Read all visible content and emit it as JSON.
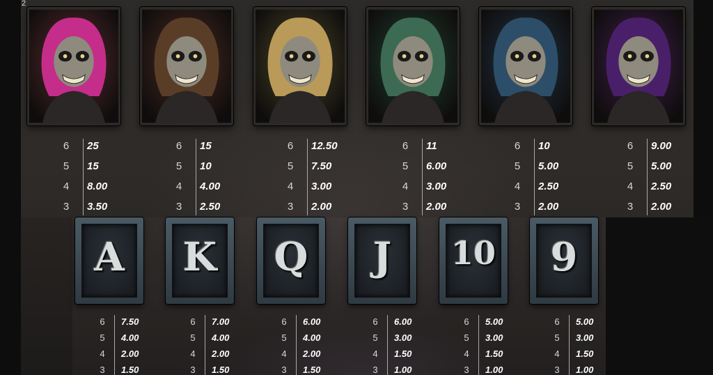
{
  "page_number": "2",
  "premium_symbols": [
    {
      "name": "pink-pompadour-zombie-symbol",
      "bg": "#5a2a2e",
      "hair": "#c52d8a",
      "pays": [
        {
          "count": "6",
          "value": "25"
        },
        {
          "count": "5",
          "value": "15"
        },
        {
          "count": "4",
          "value": "8.00"
        },
        {
          "count": "3",
          "value": "3.50"
        }
      ]
    },
    {
      "name": "cowboy-hat-zombie-symbol",
      "bg": "#4b2a20",
      "hair": "#5a3d27",
      "pays": [
        {
          "count": "6",
          "value": "15"
        },
        {
          "count": "5",
          "value": "10"
        },
        {
          "count": "4",
          "value": "4.00"
        },
        {
          "count": "3",
          "value": "2.50"
        }
      ]
    },
    {
      "name": "blonde-sunglasses-zombie-symbol",
      "bg": "#4a4426",
      "hair": "#b99a58",
      "pays": [
        {
          "count": "6",
          "value": "12.50"
        },
        {
          "count": "5",
          "value": "7.50"
        },
        {
          "count": "4",
          "value": "3.00"
        },
        {
          "count": "3",
          "value": "2.00"
        }
      ]
    },
    {
      "name": "green-hair-zombie-symbol",
      "bg": "#1f4030",
      "hair": "#3c6a52",
      "pays": [
        {
          "count": "6",
          "value": "11"
        },
        {
          "count": "5",
          "value": "6.00"
        },
        {
          "count": "4",
          "value": "3.00"
        },
        {
          "count": "3",
          "value": "2.00"
        }
      ]
    },
    {
      "name": "blue-hair-zombie-symbol",
      "bg": "#1f3446",
      "hair": "#2d4e68",
      "pays": [
        {
          "count": "6",
          "value": "10"
        },
        {
          "count": "5",
          "value": "5.00"
        },
        {
          "count": "4",
          "value": "2.50"
        },
        {
          "count": "3",
          "value": "2.00"
        }
      ]
    },
    {
      "name": "afro-headband-zombie-symbol",
      "bg": "#3d1d4a",
      "hair": "#4a1f6a",
      "pays": [
        {
          "count": "6",
          "value": "9.00"
        },
        {
          "count": "5",
          "value": "5.00"
        },
        {
          "count": "4",
          "value": "2.50"
        },
        {
          "count": "3",
          "value": "2.00"
        }
      ]
    }
  ],
  "low_symbols": [
    {
      "name": "letter-a-symbol",
      "glyph": "A",
      "pays": [
        {
          "count": "6",
          "value": "7.50"
        },
        {
          "count": "5",
          "value": "4.00"
        },
        {
          "count": "4",
          "value": "2.00"
        },
        {
          "count": "3",
          "value": "1.50"
        }
      ]
    },
    {
      "name": "letter-k-symbol",
      "glyph": "K",
      "pays": [
        {
          "count": "6",
          "value": "7.00"
        },
        {
          "count": "5",
          "value": "4.00"
        },
        {
          "count": "4",
          "value": "2.00"
        },
        {
          "count": "3",
          "value": "1.50"
        }
      ]
    },
    {
      "name": "letter-q-symbol",
      "glyph": "Q",
      "pays": [
        {
          "count": "6",
          "value": "6.00"
        },
        {
          "count": "5",
          "value": "4.00"
        },
        {
          "count": "4",
          "value": "2.00"
        },
        {
          "count": "3",
          "value": "1.50"
        }
      ]
    },
    {
      "name": "letter-j-symbol",
      "glyph": "J",
      "pays": [
        {
          "count": "6",
          "value": "6.00"
        },
        {
          "count": "5",
          "value": "3.00"
        },
        {
          "count": "4",
          "value": "1.50"
        },
        {
          "count": "3",
          "value": "1.00"
        }
      ]
    },
    {
      "name": "number-10-symbol",
      "glyph": "10",
      "pays": [
        {
          "count": "6",
          "value": "5.00"
        },
        {
          "count": "5",
          "value": "3.00"
        },
        {
          "count": "4",
          "value": "1.50"
        },
        {
          "count": "3",
          "value": "1.00"
        }
      ]
    },
    {
      "name": "number-9-symbol",
      "glyph": "9",
      "pays": [
        {
          "count": "6",
          "value": "5.00"
        },
        {
          "count": "5",
          "value": "3.00"
        },
        {
          "count": "4",
          "value": "1.50"
        },
        {
          "count": "3",
          "value": "1.00"
        }
      ]
    }
  ]
}
